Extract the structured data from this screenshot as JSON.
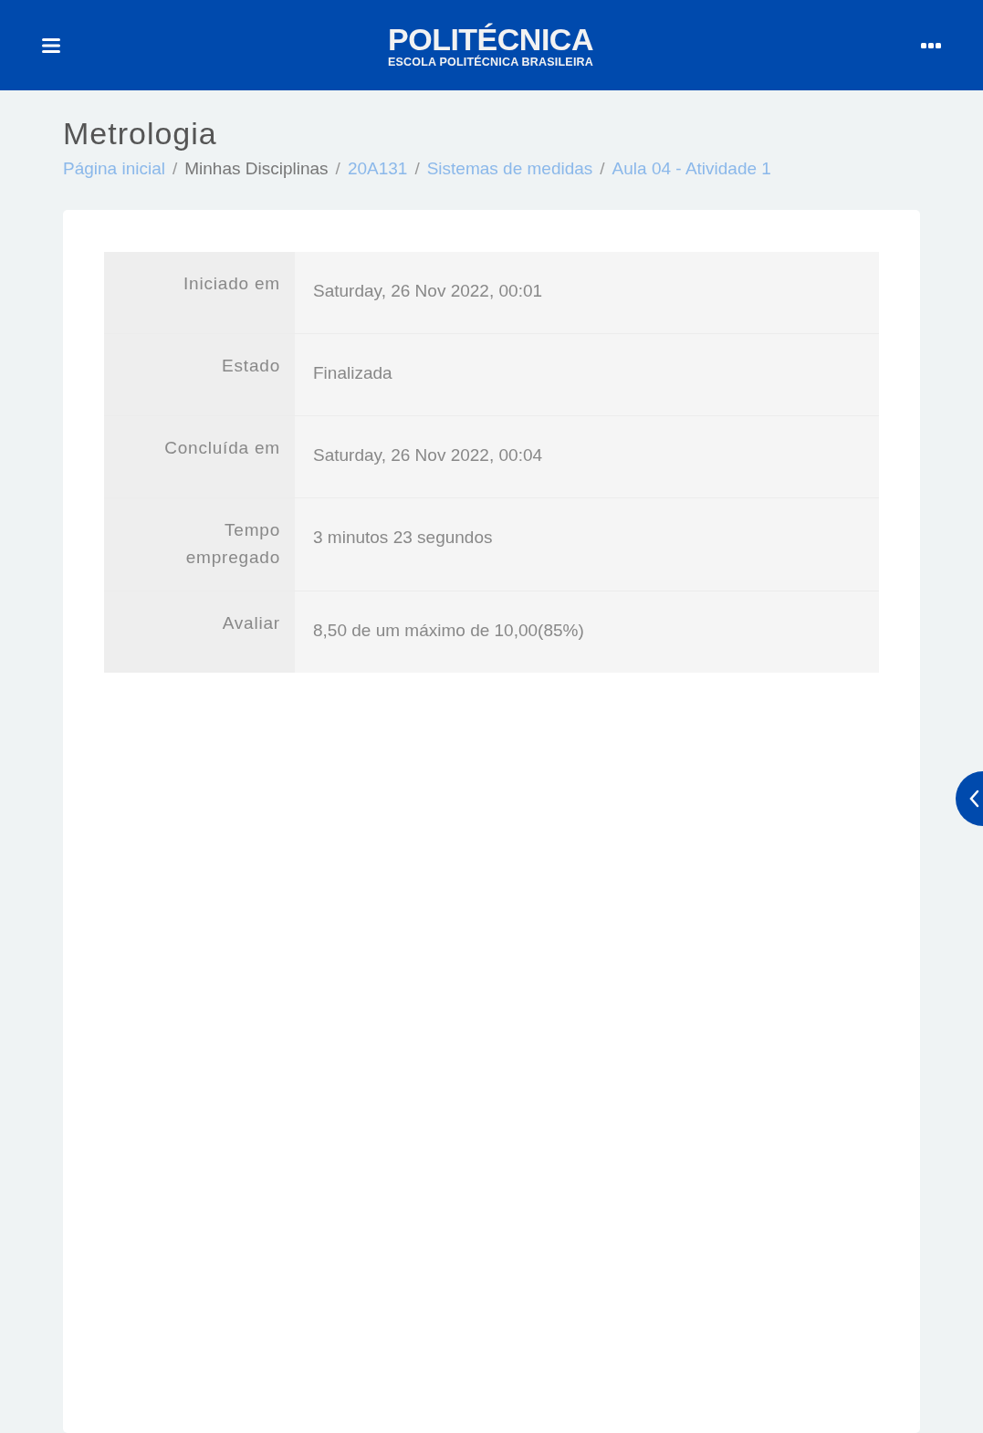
{
  "header": {
    "logo_title": "POLITÉCNICA",
    "logo_subtitle": "ESCOLA POLITÉCNICA BRASILEIRA"
  },
  "page_title": "Metrologia",
  "breadcrumb": [
    {
      "label": "Página inicial",
      "kind": "link"
    },
    {
      "label": "Minhas Disciplinas",
      "kind": "plain",
      "separator": "/"
    },
    {
      "label": "20A131",
      "kind": "link",
      "separator": "/"
    },
    {
      "label": "Sistemas de medidas",
      "kind": "link",
      "separator": "/"
    },
    {
      "label": "Aula 04 - Atividade 1",
      "kind": "link",
      "separator": "/"
    }
  ],
  "summary": [
    {
      "label": "Iniciado em",
      "value": "Saturday, 26 Nov 2022, 00:01"
    },
    {
      "label": "Estado",
      "value": "Finalizada"
    },
    {
      "label": "Concluída em",
      "value": "Saturday, 26 Nov 2022, 00:04"
    },
    {
      "label": "Tempo empregado",
      "value": "3 minutos 23 segundos"
    },
    {
      "label": "Avaliar",
      "value": "8,50 de um máximo de 10,00(85%)"
    }
  ]
}
